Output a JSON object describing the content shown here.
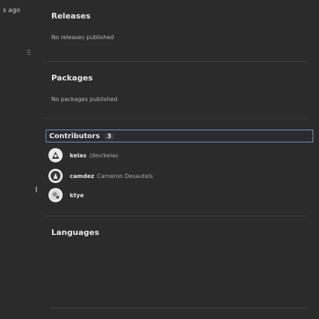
{
  "left": {
    "time_ago": "s ago"
  },
  "releases": {
    "title": "Releases",
    "empty_text": "No releases published"
  },
  "packages": {
    "title": "Packages",
    "empty_text": "No packages published"
  },
  "contributors": {
    "title": "Contributors",
    "count": "3",
    "items": [
      {
        "login": "kelas",
        "name": "/dev/kelas"
      },
      {
        "login": "camdez",
        "name": "Cameron Desautels"
      },
      {
        "login": "ktye",
        "name": ""
      }
    ]
  },
  "languages": {
    "title": "Languages"
  }
}
